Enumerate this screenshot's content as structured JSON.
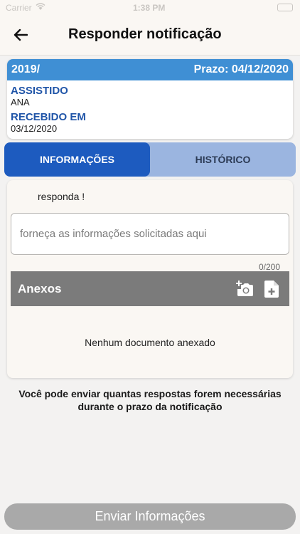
{
  "status_bar": {
    "carrier": "Carrier",
    "time": "1:38 PM"
  },
  "header": {
    "back_icon": "arrow-left-icon",
    "title": "Responder notificação"
  },
  "notification": {
    "number": "2019/",
    "deadline": "Prazo: 04/12/2020",
    "assisted_label": "ASSISTIDO",
    "assisted_value": "ANA",
    "received_label": "RECEBIDO EM",
    "received_value": "03/12/2020"
  },
  "tabs": [
    {
      "label": "INFORMAÇÕES",
      "active": true
    },
    {
      "label": "HISTÓRICO",
      "active": false
    }
  ],
  "form": {
    "question": "responda !",
    "answer_placeholder": "forneça as informações solicitadas aqui",
    "answer_value": "",
    "char_count": "0/200"
  },
  "attachments": {
    "title": "Anexos",
    "add_photo_icon": "add-photo-icon",
    "add_file_icon": "add-file-icon",
    "empty_message": "Nenhum documento anexado"
  },
  "info_note": "Você pode enviar quantas respostas forem necessárias durante o prazo da notificação",
  "submit_label": "Enviar Informações",
  "colors": {
    "header_bar": "#3f8fd4",
    "label_blue": "#2055a8",
    "tab_active": "#1d5bbf",
    "tab_inactive": "#9bb5e0",
    "attachments_bar": "#7b7b7b",
    "submit_disabled": "#a9a9a9"
  }
}
